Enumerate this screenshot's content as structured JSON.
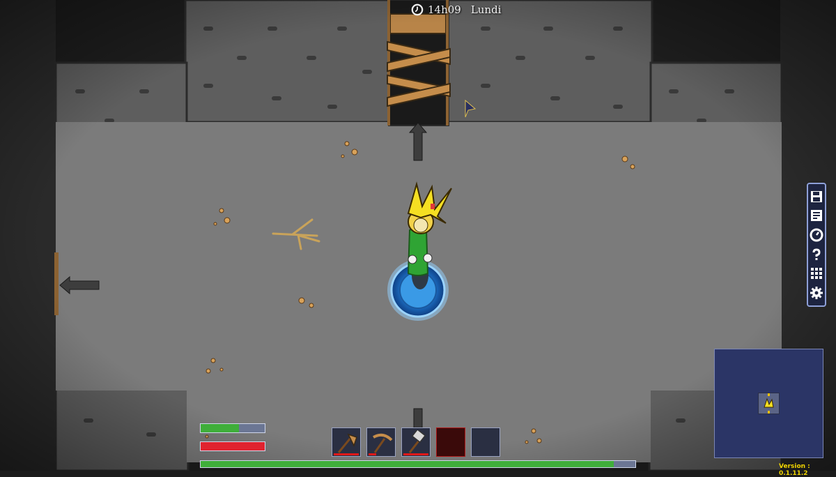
{
  "hud": {
    "time": "14h09",
    "day": "Lundi"
  },
  "version_label": "Version : 0.1.11.2",
  "stats": {
    "stamina_level": 0.6,
    "health_level": 1.0,
    "experience_level": 0.95,
    "stamina_color": "#3fae3a",
    "health_color": "#e0232f",
    "experience_color": "#3fae3a"
  },
  "hotbar": {
    "slots": [
      {
        "item_icon": "axe-icon",
        "durability": 0.95
      },
      {
        "item_icon": "pickaxe-icon",
        "durability": 0.3
      },
      {
        "item_icon": "hammer-icon",
        "durability": 0.95
      },
      {
        "item_icon": "empty",
        "selected": true
      },
      {
        "item_icon": "empty"
      }
    ]
  },
  "side_menu": [
    "save-icon",
    "journal-icon",
    "clock-icon",
    "help-icon",
    "inventory-grid-icon",
    "settings-gear-icon"
  ],
  "colors": {
    "floor": "#7b7b7b",
    "wall": "#5e5e5e",
    "void": "#1e1e1e",
    "menu_border": "#8ea0d8",
    "minimap_bg": "#2b3566",
    "version_text": "#f0d400"
  }
}
